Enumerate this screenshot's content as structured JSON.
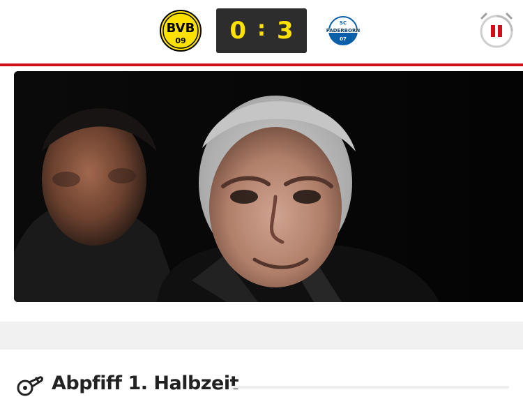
{
  "scoreboard": {
    "home_team": {
      "logo_text_top": "BVB",
      "logo_text_bottom": "09",
      "logo_color": "#fde100",
      "logo_ink": "#000000"
    },
    "score_home": "0",
    "score_separator": ":",
    "score_away": "3",
    "away_team": {
      "logo_text_top": "SC",
      "logo_text_middle": "PADERBORN",
      "logo_text_bottom": "07",
      "logo_color": "#0a5fa8"
    },
    "pause_icon": "pause-icon",
    "accent_red": "#d10f1b",
    "score_color": "#ffe200"
  },
  "hero": {
    "image_icon": "photo"
  },
  "ticker": {
    "event_icon": "whistle-icon",
    "event_title": "Abpfiff 1. Halbzeit"
  }
}
